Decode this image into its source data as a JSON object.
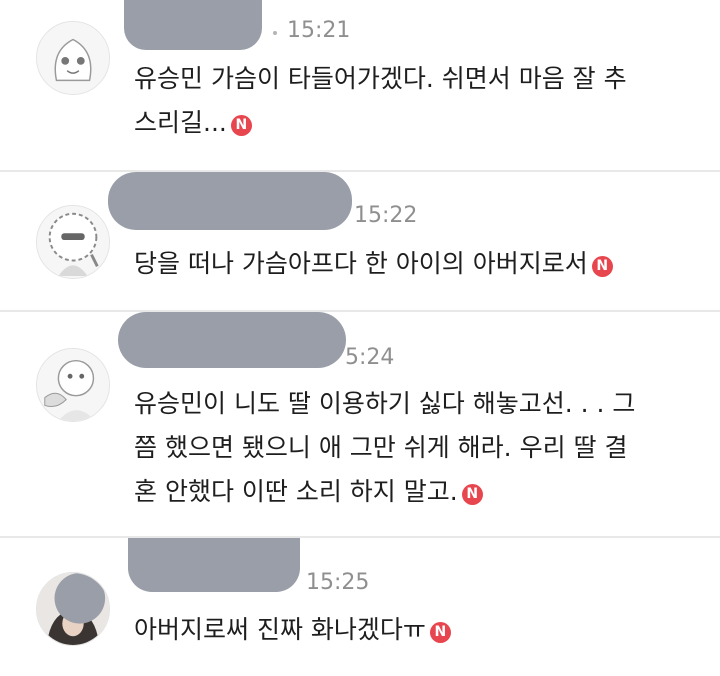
{
  "badge_letter": "N",
  "badge_color": "#e8464f",
  "comments": [
    {
      "avatar_icon": "peach-character-icon",
      "time": "15:21",
      "lines": [
        "유승민 가슴이 타들어가겠다. 쉬면서 마음 잘 추",
        "스리길..."
      ]
    },
    {
      "avatar_icon": "ryan-curly-character-icon",
      "time": "15:22",
      "lines": [
        "당을 떠나 가슴아프다 한 아이의 아버지로서"
      ]
    },
    {
      "avatar_icon": "waving-character-icon",
      "time": "5:24",
      "lines": [
        "유승민이 니도 딸 이용하기 싫다 해놓고선. . . 그",
        "쯤 했으면 됐으니 애 그만 쉬게 해라. 우리 딸 결",
        "혼 안했다 이딴 소리 하지 말고."
      ]
    },
    {
      "avatar_icon": "person-photo-icon",
      "time": "15:25",
      "lines": [
        "아버지로써 진짜 화나겠다ㅠ"
      ]
    }
  ]
}
